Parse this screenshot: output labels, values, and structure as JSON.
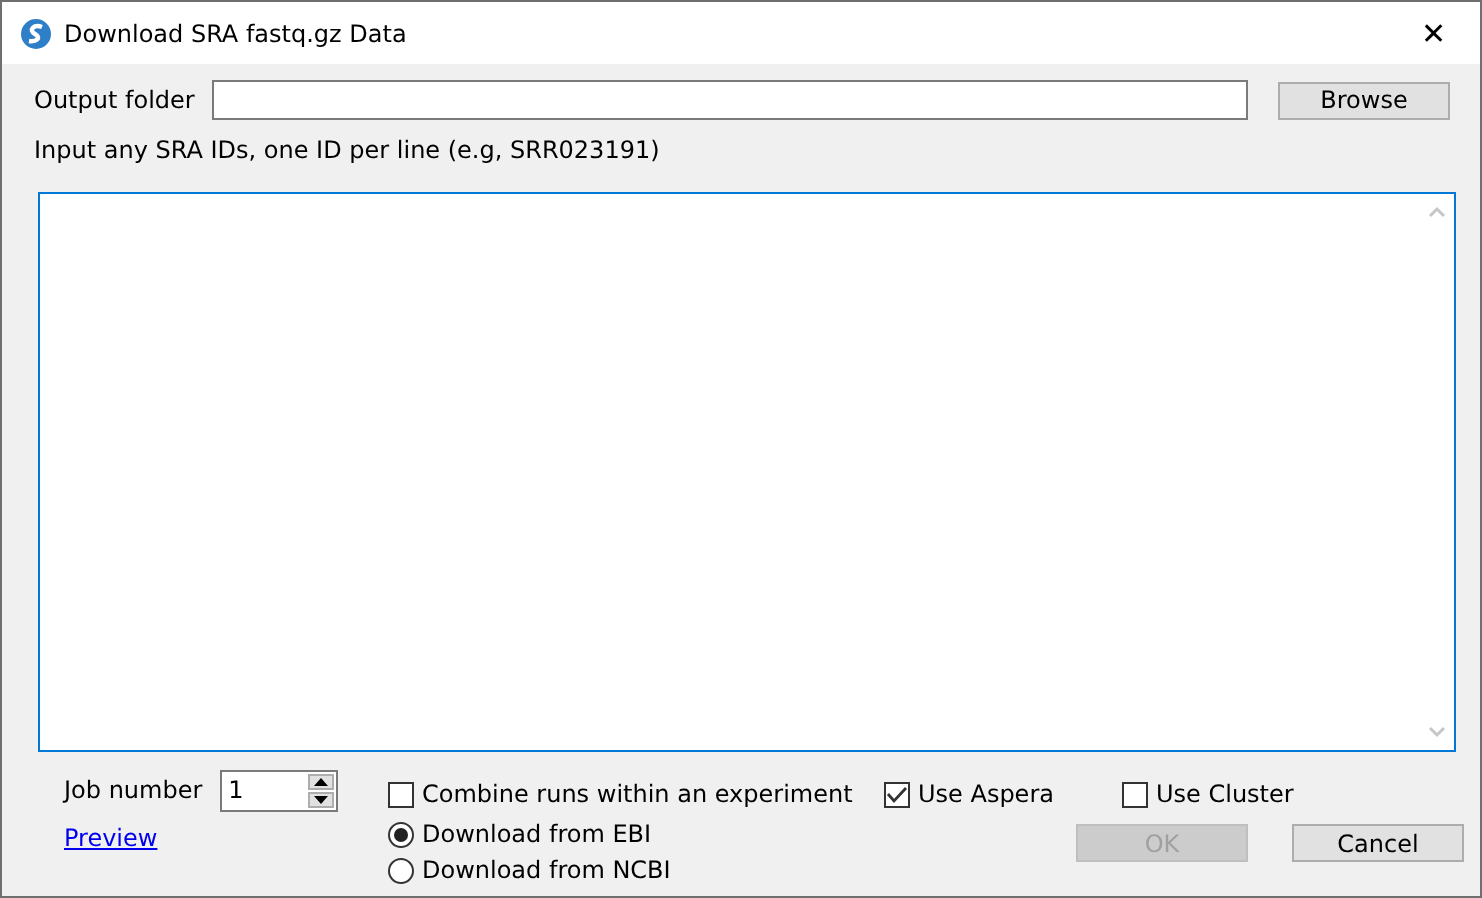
{
  "window": {
    "title": "Download SRA fastq.gz Data",
    "close": "✕"
  },
  "output_folder": {
    "label": "Output folder",
    "browse": "Browse"
  },
  "hint": "Input any SRA IDs, one ID per line (e.g, SRR023191)",
  "job_number": {
    "label": "Job number",
    "value": "1"
  },
  "checkboxes": [
    {
      "label": "Combine runs within an experiment",
      "checked": false
    },
    {
      "label": "Use Aspera",
      "checked": true
    },
    {
      "label": "Use Cluster",
      "checked": false
    }
  ],
  "preview": "Preview",
  "radios": [
    {
      "label": "Download from EBI",
      "selected": true
    },
    {
      "label": "Download from NCBI",
      "selected": false
    }
  ],
  "buttons": [
    {
      "label": "OK",
      "disabled": true
    },
    {
      "label": "Cancel",
      "disabled": false
    }
  ]
}
